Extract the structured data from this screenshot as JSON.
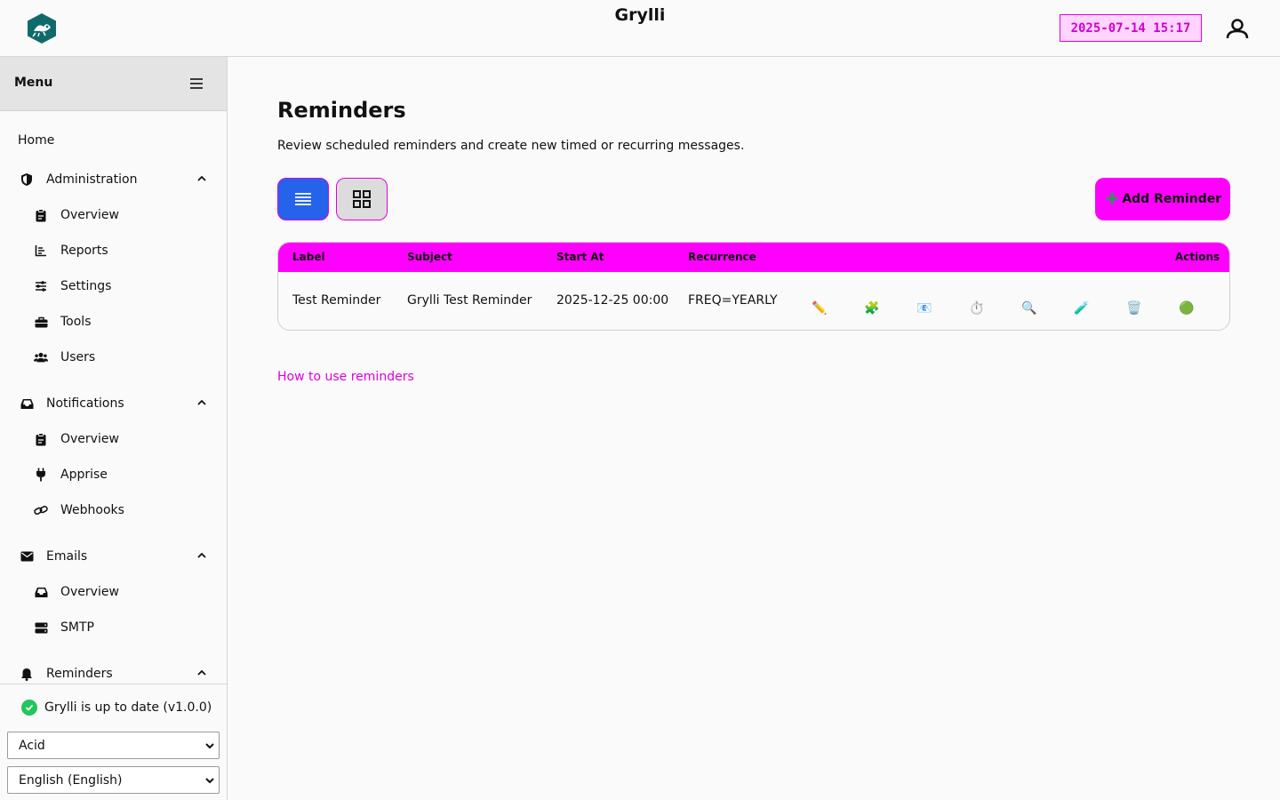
{
  "header": {
    "title": "Grylli",
    "clock": "2025-07-14 15:17",
    "logo_icon": "grylli-logo-icon",
    "user_icon": "user-icon"
  },
  "sidebar": {
    "menu_label": "Menu",
    "items": [
      {
        "label": "Home"
      },
      {
        "label": "Administration",
        "icon": "shield-icon"
      },
      {
        "label": "Overview",
        "icon": "clipboard-icon"
      },
      {
        "label": "Reports",
        "icon": "chart-icon"
      },
      {
        "label": "Settings",
        "icon": "sliders-icon"
      },
      {
        "label": "Tools",
        "icon": "toolbox-icon"
      },
      {
        "label": "Users",
        "icon": "users-icon"
      },
      {
        "label": "Notifications",
        "icon": "inbox-icon"
      },
      {
        "label": "Overview",
        "icon": "clipboard-icon"
      },
      {
        "label": "Apprise",
        "icon": "plug-icon"
      },
      {
        "label": "Webhooks",
        "icon": "link-icon"
      },
      {
        "label": "Emails",
        "icon": "envelope-icon"
      },
      {
        "label": "Overview",
        "icon": "inbox-icon"
      },
      {
        "label": "SMTP",
        "icon": "server-icon"
      },
      {
        "label": "Reminders",
        "icon": "bell-icon"
      }
    ],
    "status": "Grylli is up to date (v1.0.0)",
    "theme_select": "Acid",
    "language_select": "English (English)"
  },
  "main": {
    "title": "Reminders",
    "description": "Review scheduled reminders and create new timed or recurring messages.",
    "add_button": "Add Reminder",
    "table": {
      "columns": [
        "Label",
        "Subject",
        "Start At",
        "Recurrence",
        "Actions"
      ],
      "rows": [
        {
          "label": "Test Reminder",
          "subject": "Grylli Test Reminder",
          "start_at": "2025-12-25 00:00",
          "recurrence": "FREQ=YEARLY"
        }
      ],
      "actions": [
        {
          "name": "edit-icon",
          "glyph": "✏️"
        },
        {
          "name": "puzzle-icon",
          "glyph": "🧩"
        },
        {
          "name": "email-icon",
          "glyph": "📧"
        },
        {
          "name": "timer-icon",
          "glyph": "⏱️"
        },
        {
          "name": "search-icon",
          "glyph": "🔍"
        },
        {
          "name": "test-tube-icon",
          "glyph": "🧪"
        },
        {
          "name": "trash-icon",
          "glyph": "🗑️"
        },
        {
          "name": "status-green-icon",
          "glyph": "🟢"
        }
      ]
    },
    "help_link": "How to use reminders"
  },
  "colors": {
    "accent": "#ff00ff",
    "primary": "#2563eb",
    "success": "#22c55e"
  }
}
